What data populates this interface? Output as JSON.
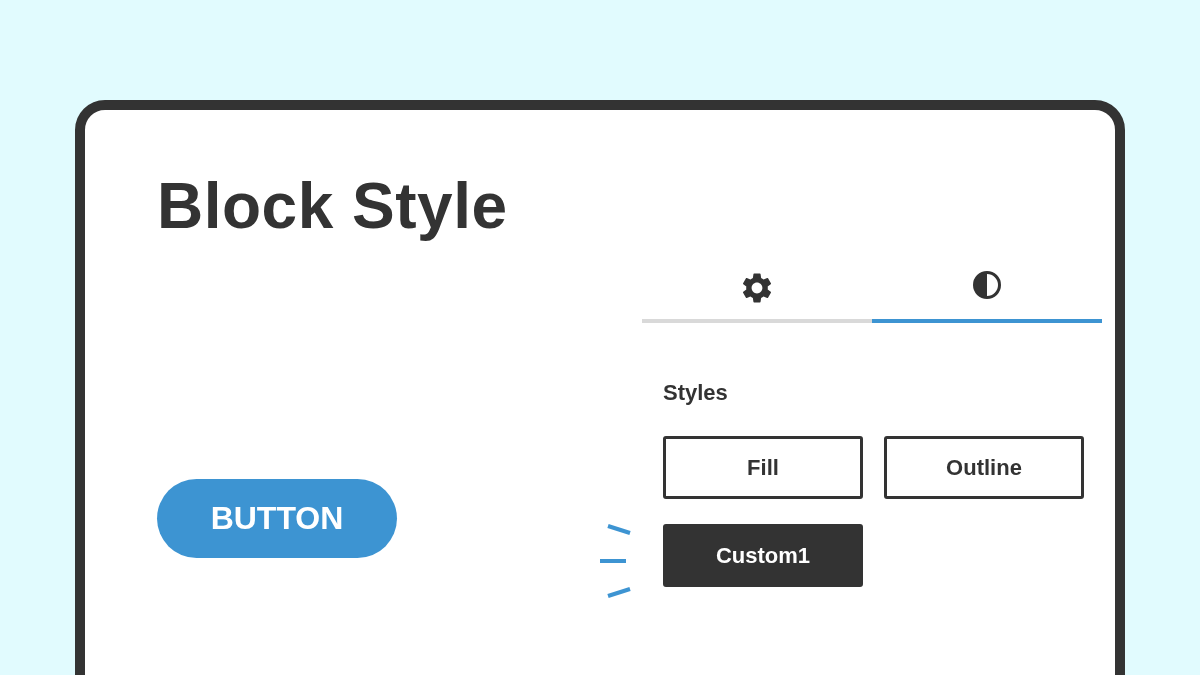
{
  "title": "Block Style",
  "preview_button": {
    "label": "BUTTON"
  },
  "tabs": [
    {
      "kind": "settings",
      "selected": false
    },
    {
      "kind": "styles",
      "selected": true
    }
  ],
  "styles_heading": "Styles",
  "styles": [
    {
      "label": "Fill",
      "selected": false
    },
    {
      "label": "Outline",
      "selected": false
    },
    {
      "label": "Custom1",
      "selected": true
    }
  ]
}
